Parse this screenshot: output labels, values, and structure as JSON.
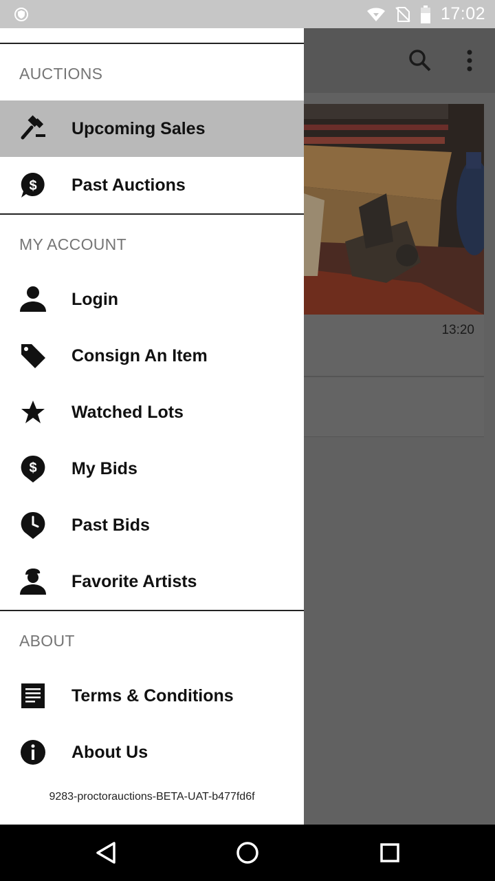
{
  "status_bar": {
    "time": "17:02",
    "icons": [
      "shield-icon",
      "wifi-icon",
      "no-sim-icon",
      "battery-icon"
    ]
  },
  "background_app": {
    "toolbar_icons": [
      "search-icon",
      "more-vert-icon"
    ],
    "card_time": "13:20"
  },
  "drawer": {
    "sections": {
      "auctions": "AUCTIONS",
      "my_account": "MY ACCOUNT",
      "about": "ABOUT"
    },
    "items": {
      "upcoming_sales": {
        "label": "Upcoming Sales",
        "icon": "gavel-icon",
        "selected": true
      },
      "past_auctions": {
        "label": "Past Auctions",
        "icon": "dollar-bubble-icon"
      },
      "login": {
        "label": "Login",
        "icon": "person-icon"
      },
      "consign": {
        "label": "Consign An Item",
        "icon": "tag-icon"
      },
      "watched_lots": {
        "label": "Watched Lots",
        "icon": "star-icon"
      },
      "my_bids": {
        "label": "My Bids",
        "icon": "dollar-pin-icon"
      },
      "past_bids": {
        "label": "Past Bids",
        "icon": "clock-pin-icon"
      },
      "favorite_artists": {
        "label": "Favorite Artists",
        "icon": "artist-icon"
      },
      "terms": {
        "label": "Terms & Conditions",
        "icon": "document-icon"
      },
      "about_us": {
        "label": "About Us",
        "icon": "info-icon"
      }
    },
    "version": "9283-proctorauctions-BETA-UAT-b477fd6f"
  },
  "nav_bar": {
    "buttons": [
      "back-icon",
      "home-icon",
      "recents-icon"
    ]
  },
  "colors": {
    "selected_item_bg": "#b9b9b9",
    "section_header": "#757575",
    "scrim": "#616161",
    "status_bar": "#c6c6c6"
  }
}
